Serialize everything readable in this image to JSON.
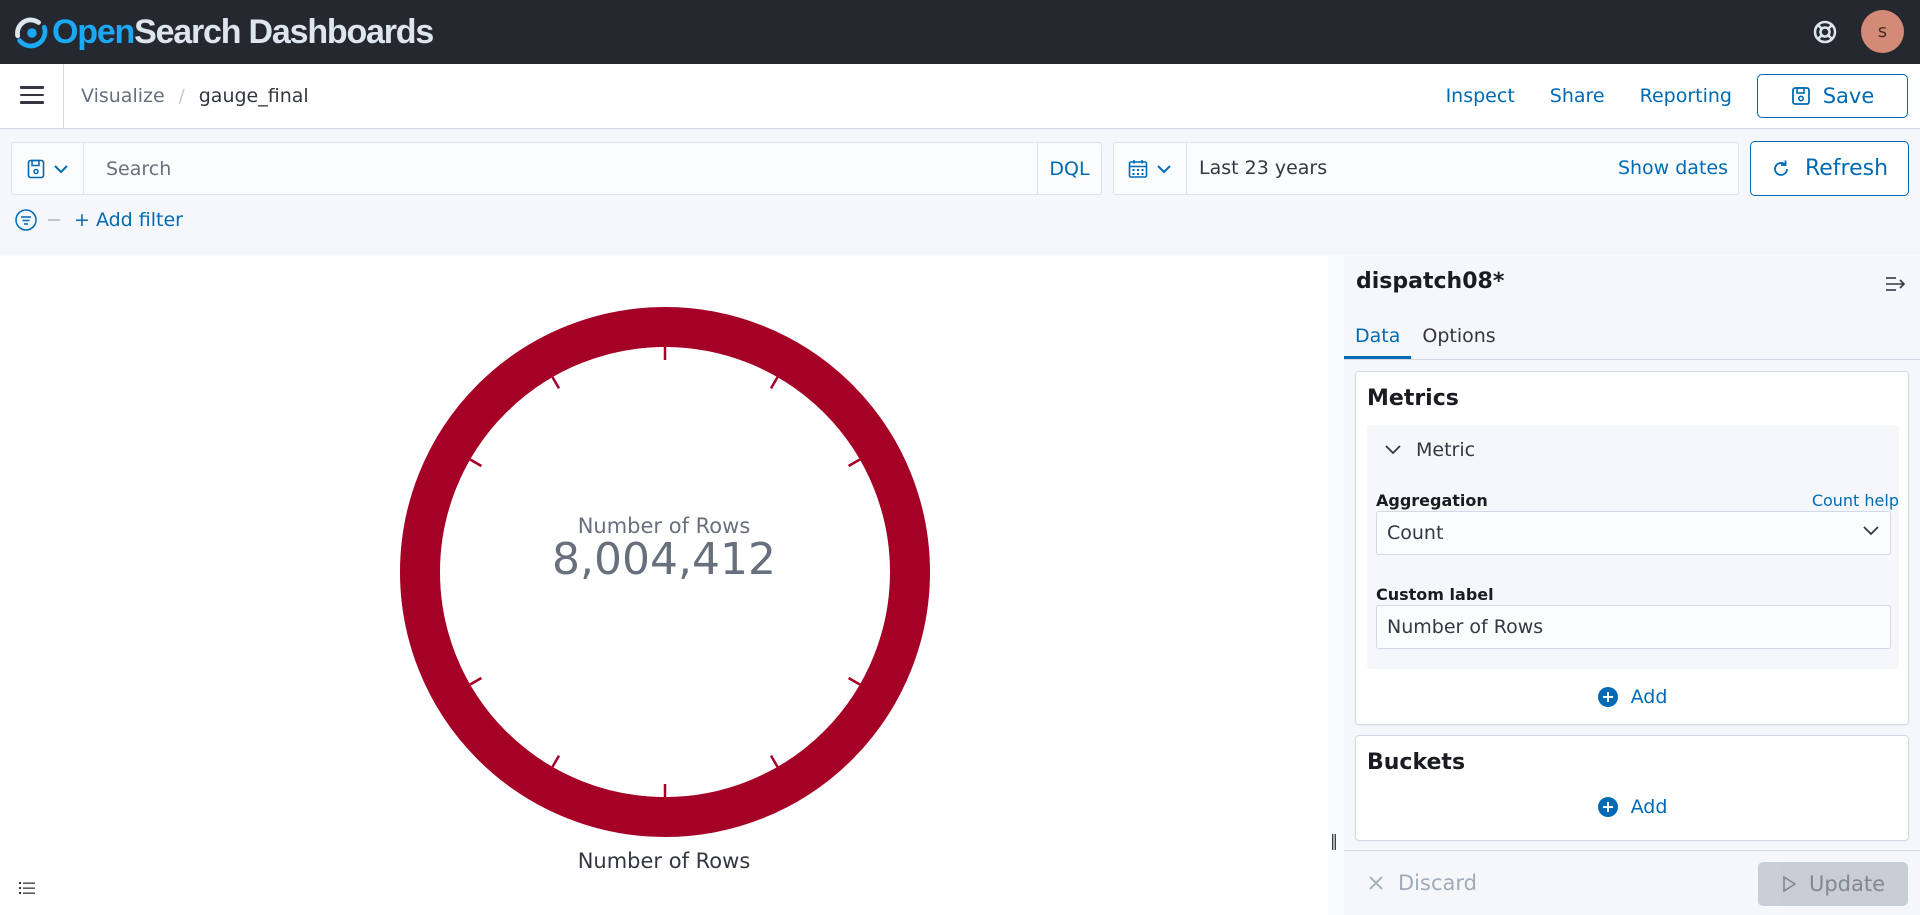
{
  "header": {
    "brand_open": "Open",
    "brand_rest": "Search Dashboards",
    "help_icon": "help-life-ring-icon",
    "avatar_initial": "s"
  },
  "nav": {
    "breadcrumb_parent": "Visualize",
    "breadcrumb_separator": "/",
    "breadcrumb_current": "gauge_final",
    "links": [
      "Inspect",
      "Share",
      "Reporting"
    ],
    "save_label": "Save"
  },
  "query": {
    "search_placeholder": "Search",
    "search_value": "",
    "language": "DQL",
    "date_range": "Last 23 years",
    "show_dates": "Show dates",
    "refresh_label": "Refresh",
    "add_filter": "+ Add filter"
  },
  "visualization": {
    "gauge_title": "Number of Rows",
    "gauge_value": "8,004,412",
    "gauge_label": "Number of Rows",
    "gauge_color": "#a50026",
    "gauge_fill_fraction": 1.0,
    "tick_count": 12
  },
  "editor": {
    "index_pattern": "dispatch08*",
    "tabs": [
      "Data",
      "Options"
    ],
    "active_tab": "Data",
    "metrics_title": "Metrics",
    "metric_header": "Metric",
    "aggregation_label": "Aggregation",
    "aggregation_help": "Count help",
    "aggregation_value": "Count",
    "custom_label_label": "Custom label",
    "custom_label_value": "Number of Rows",
    "add_label": "Add",
    "buckets_title": "Buckets",
    "discard_label": "Discard",
    "update_label": "Update"
  },
  "colors": {
    "accent": "#006bb4",
    "header_bg": "#25282f",
    "gauge": "#a50026"
  }
}
